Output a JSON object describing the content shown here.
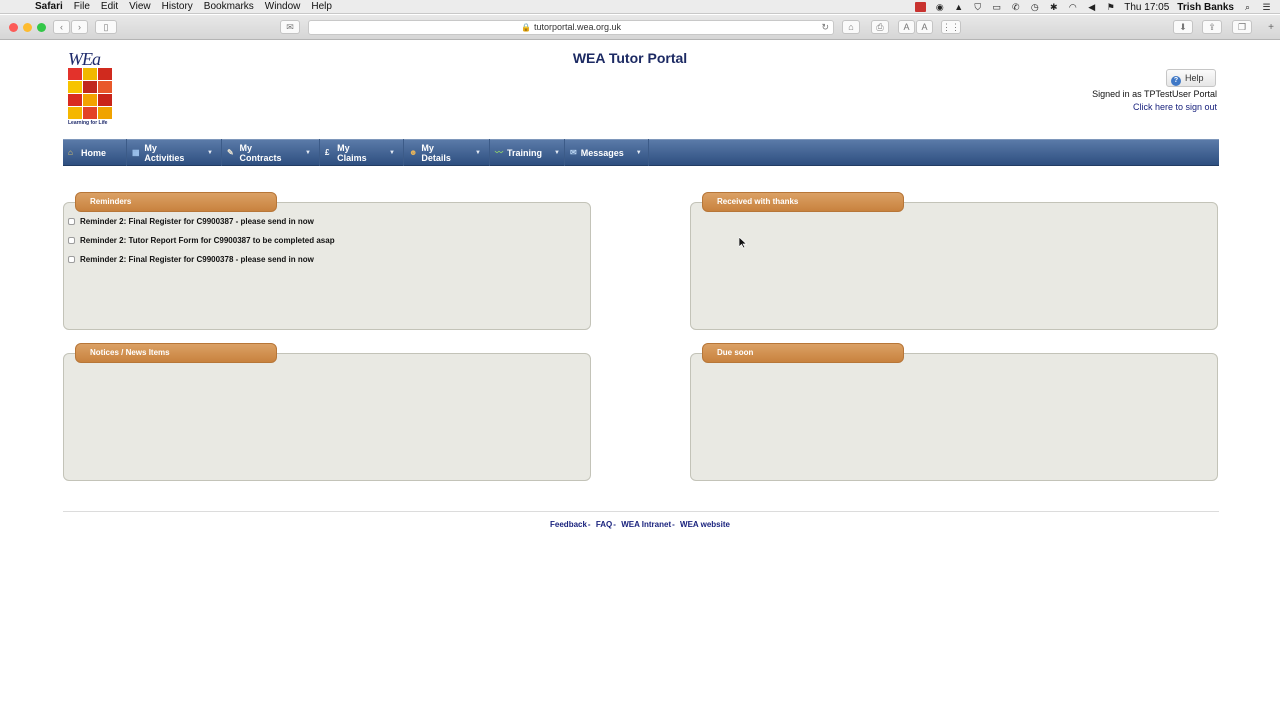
{
  "menubar": {
    "app": "Safari",
    "items": [
      "File",
      "Edit",
      "View",
      "History",
      "Bookmarks",
      "Window",
      "Help"
    ],
    "clock": "Thu 17:05",
    "user": "Trish Banks"
  },
  "browser": {
    "url": "tutorportal.wea.org.uk",
    "font_small": "A",
    "font_large": "A"
  },
  "header": {
    "title": "WEA Tutor Portal",
    "logo_text": "WEa",
    "logo_tagline": "Learning for Life",
    "help_label": "Help",
    "signed_in": "Signed in as TPTestUser Portal",
    "sign_out": "Click here to sign out"
  },
  "nav": {
    "items": [
      {
        "label": "Home"
      },
      {
        "label": "My Activities"
      },
      {
        "label": "My Contracts"
      },
      {
        "label": "My Claims"
      },
      {
        "label": "My Details"
      },
      {
        "label": "Training"
      },
      {
        "label": "Messages"
      }
    ]
  },
  "panels": {
    "reminders": {
      "title": "Reminders",
      "items": [
        "Reminder 2: Final Register for C9900387 - please send in now",
        "Reminder 2: Tutor Report Form for C9900387 to be completed asap",
        "Reminder 2: Final Register for C9900378 - please send in now"
      ]
    },
    "received": {
      "title": "Received with thanks"
    },
    "notices": {
      "title": "Notices / News Items"
    },
    "due": {
      "title": "Due soon"
    }
  },
  "footer": {
    "links": [
      "Feedback",
      "FAQ",
      "WEA Intranet",
      "WEA website"
    ]
  },
  "colors": {
    "nav_bg": "#3b5c8c",
    "panel_head": "#d08e4b",
    "panel_bg": "#e9e9e3",
    "title_blue": "#1c2a63"
  }
}
